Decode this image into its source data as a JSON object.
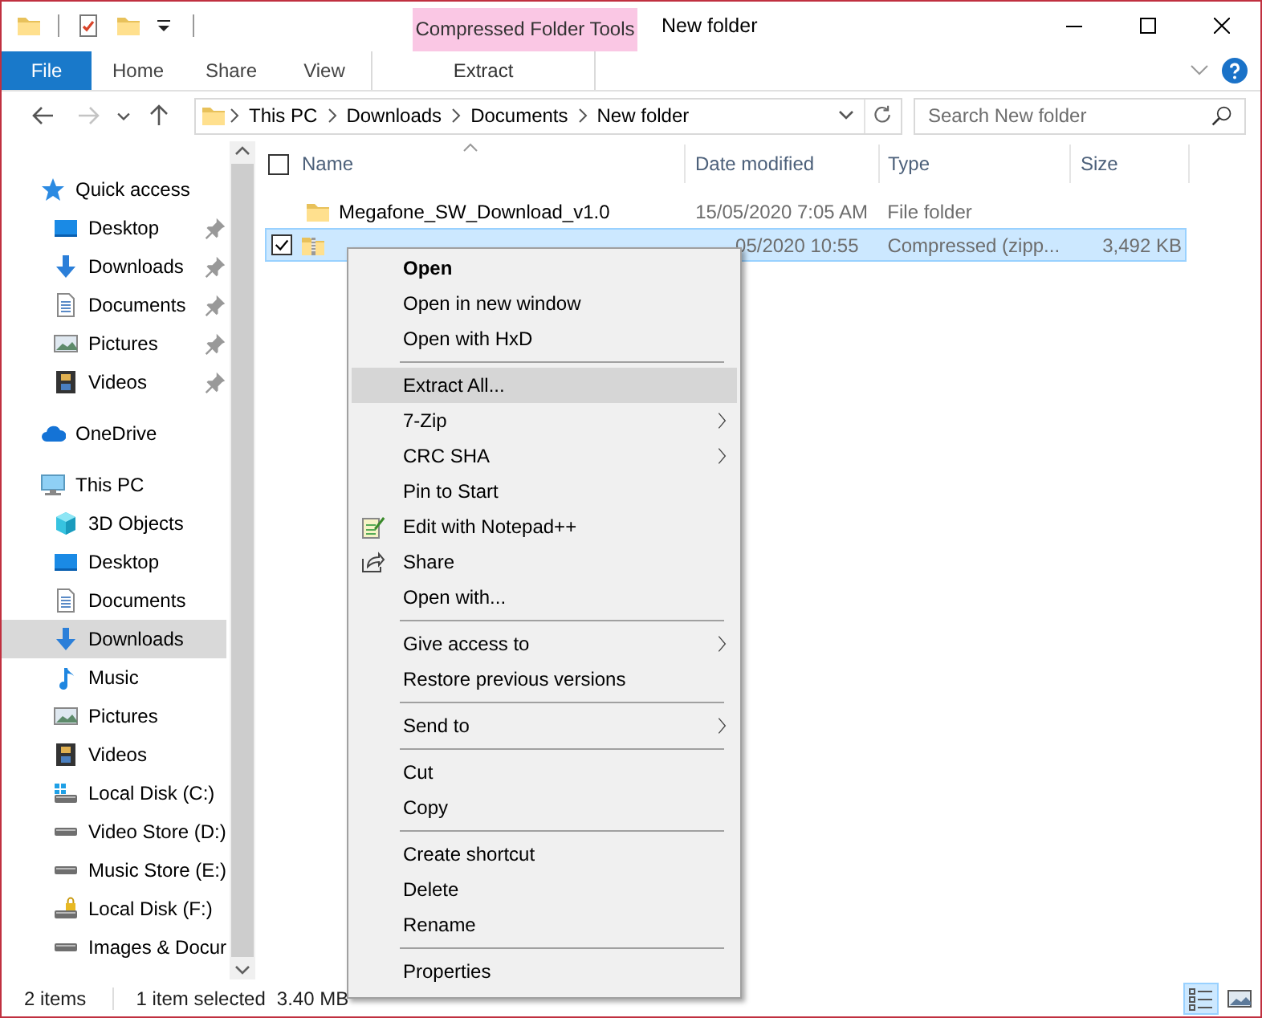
{
  "title_bar": {
    "contextual_group": "Compressed Folder Tools",
    "title": "New folder"
  },
  "ribbon_tabs": [
    {
      "label": "File",
      "kind": "file"
    },
    {
      "label": "Home",
      "kind": "tab"
    },
    {
      "label": "Share",
      "kind": "tab"
    },
    {
      "label": "View",
      "kind": "tab"
    },
    {
      "label": "Extract",
      "kind": "contextual"
    }
  ],
  "nav_buttons": [
    {
      "kind": "back",
      "disabled": false
    },
    {
      "kind": "forward",
      "disabled": true
    },
    {
      "kind": "recent",
      "disabled": false
    },
    {
      "kind": "up",
      "disabled": false
    }
  ],
  "address_bar": {
    "breadcrumbs": [
      "This PC",
      "Downloads",
      "Documents",
      "New folder"
    ]
  },
  "search": {
    "placeholder": "Search New folder"
  },
  "sidebar": {
    "items": [
      {
        "label": "Quick access",
        "kind": "star",
        "selected": false,
        "children": [
          {
            "label": "Desktop",
            "kind": "desktop",
            "selected": false,
            "pinned": true
          },
          {
            "label": "Downloads",
            "kind": "downloads",
            "selected": false,
            "pinned": true
          },
          {
            "label": "Documents",
            "kind": "documents",
            "selected": false,
            "pinned": true
          },
          {
            "label": "Pictures",
            "kind": "pictures",
            "selected": false,
            "pinned": true
          },
          {
            "label": "Videos",
            "kind": "videos",
            "selected": false,
            "pinned": true
          }
        ]
      },
      {
        "label": "OneDrive",
        "kind": "cloud",
        "selected": false
      },
      {
        "label": "This PC",
        "kind": "computer",
        "selected": false,
        "children": [
          {
            "label": "3D Objects",
            "kind": "cube",
            "selected": false,
            "pinned": false
          },
          {
            "label": "Desktop",
            "kind": "desktop",
            "selected": false,
            "pinned": false
          },
          {
            "label": "Documents",
            "kind": "documents",
            "selected": false,
            "pinned": false
          },
          {
            "label": "Downloads",
            "kind": "downloads",
            "selected": true,
            "pinned": false
          },
          {
            "label": "Music",
            "kind": "music",
            "selected": false,
            "pinned": false
          },
          {
            "label": "Pictures",
            "kind": "pictures",
            "selected": false,
            "pinned": false
          },
          {
            "label": "Videos",
            "kind": "videos",
            "selected": false,
            "pinned": false
          },
          {
            "label": "Local Disk (C:)",
            "kind": "system-disk",
            "selected": false,
            "pinned": false
          },
          {
            "label": "Video Store (D:)",
            "kind": "disk",
            "selected": false,
            "pinned": false
          },
          {
            "label": "Music Store (E:)",
            "kind": "disk",
            "selected": false,
            "pinned": false
          },
          {
            "label": "Local Disk (F:)",
            "kind": "locked-disk",
            "selected": false,
            "pinned": false
          },
          {
            "label": "Images & Docur",
            "kind": "disk",
            "selected": false,
            "pinned": false
          }
        ]
      }
    ]
  },
  "file_list": {
    "select_all_checked": false,
    "columns": [
      "Name",
      "Date modified",
      "Type",
      "Size"
    ],
    "rows": [
      {
        "kind": "folder",
        "name": "Megafone_SW_Download_v1.0",
        "date": "15/05/2020 7:05 AM",
        "type": "File folder",
        "selected": false
      },
      {
        "kind": "zip",
        "date": "05/2020 10:55",
        "type": "Compressed (zipp...",
        "size": "3,492 KB",
        "selected": true
      }
    ]
  },
  "context_menu": {
    "groups": [
      [
        {
          "label": "Open",
          "kind": "default",
          "selected": false
        },
        {
          "label": "Open in new window",
          "kind": "item",
          "selected": false
        },
        {
          "label": "Open with HxD",
          "kind": "item",
          "selected": false
        }
      ],
      [
        {
          "label": "Extract All...",
          "kind": "item",
          "selected": true
        },
        {
          "label": "7-Zip",
          "kind": "submenu",
          "selected": false
        },
        {
          "label": "CRC SHA",
          "kind": "submenu",
          "selected": false
        },
        {
          "label": "Pin to Start",
          "kind": "item",
          "selected": false
        },
        {
          "label": "Edit with Notepad++",
          "kind": "notepad",
          "selected": false
        },
        {
          "label": "Share",
          "kind": "share",
          "selected": false
        },
        {
          "label": "Open with...",
          "kind": "item",
          "selected": false
        }
      ],
      [
        {
          "label": "Give access to",
          "kind": "submenu",
          "selected": false
        },
        {
          "label": "Restore previous versions",
          "kind": "item",
          "selected": false
        }
      ],
      [
        {
          "label": "Send to",
          "kind": "submenu",
          "selected": false
        }
      ],
      [
        {
          "label": "Cut",
          "kind": "item",
          "selected": false
        },
        {
          "label": "Copy",
          "kind": "item",
          "selected": false
        }
      ],
      [
        {
          "label": "Create shortcut",
          "kind": "item",
          "selected": false
        },
        {
          "label": "Delete",
          "kind": "item",
          "selected": false
        },
        {
          "label": "Rename",
          "kind": "item",
          "selected": false
        }
      ],
      [
        {
          "label": "Properties",
          "kind": "item",
          "selected": false
        }
      ]
    ]
  },
  "status_bar": {
    "item_count": "2 items",
    "selection": "1 item selected",
    "selection_size": "3.40 MB",
    "view_buttons": [
      {
        "kind": "details",
        "selected": true
      },
      {
        "kind": "large-icons",
        "selected": false
      }
    ]
  }
}
